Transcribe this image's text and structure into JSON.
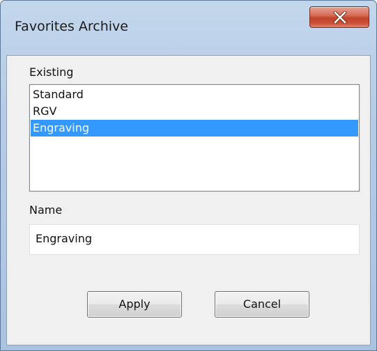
{
  "window": {
    "title": "Favorites Archive",
    "close_icon": "close-icon"
  },
  "existing": {
    "label": "Existing",
    "items": [
      "Standard",
      "RGV",
      "Engraving"
    ],
    "selected": "Engraving"
  },
  "name": {
    "label": "Name",
    "value": "Engraving"
  },
  "buttons": {
    "apply": "Apply",
    "cancel": "Cancel"
  },
  "colors": {
    "selection": "#3399ff",
    "close_button": "#c1432a"
  }
}
